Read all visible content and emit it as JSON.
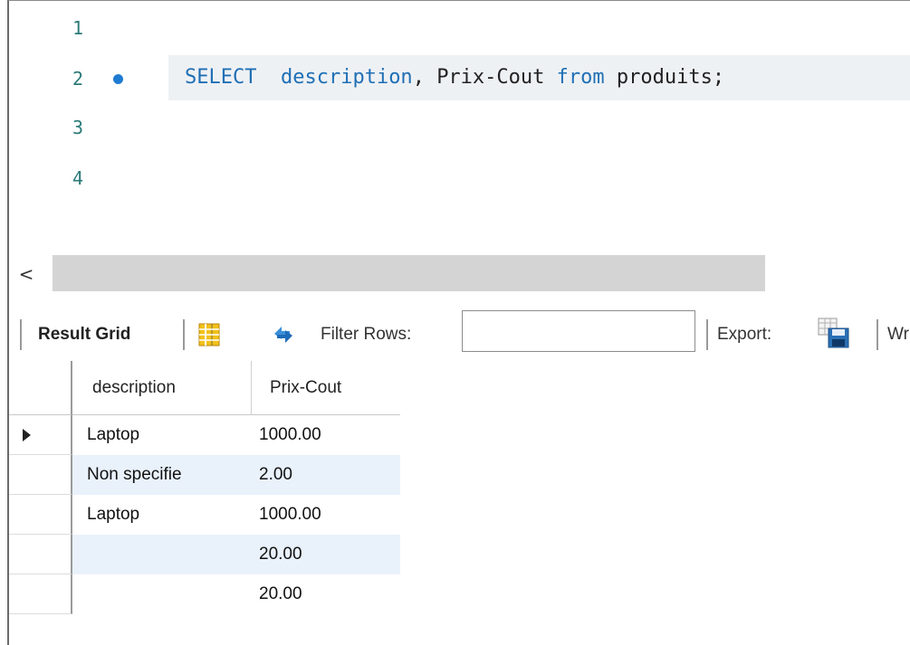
{
  "editor": {
    "line_numbers": [
      "1",
      "2",
      "3",
      "4"
    ],
    "code": {
      "select_kw": "SELECT",
      "field1": "description",
      "comma": ",",
      "field2": "Prix-Cout",
      "from_kw": "from",
      "table": "produits;"
    }
  },
  "scrollbar": {
    "left_arrow": "<"
  },
  "toolbar": {
    "result_grid_label": "Result Grid",
    "filter_rows_label": "Filter Rows:",
    "filter_value": "",
    "export_label": "Export:",
    "wrap_label": "Wr"
  },
  "icons": {
    "grid": "grid-layout-icon",
    "refresh": "refresh-icon",
    "export": "export-save-icon"
  },
  "colors": {
    "keyword": "#1f6fb5",
    "exec_dot": "#1f7bd1",
    "alt_row": "#e9f1fb"
  },
  "grid": {
    "columns": [
      "description",
      "Prix-Cout"
    ],
    "rows": [
      {
        "description": "Laptop",
        "prix_cout": "1000.00"
      },
      {
        "description": "Non specifie",
        "prix_cout": "2.00"
      },
      {
        "description": "Laptop",
        "prix_cout": "1000.00"
      },
      {
        "description": "",
        "prix_cout": "20.00"
      },
      {
        "description": "",
        "prix_cout": "20.00"
      }
    ]
  }
}
